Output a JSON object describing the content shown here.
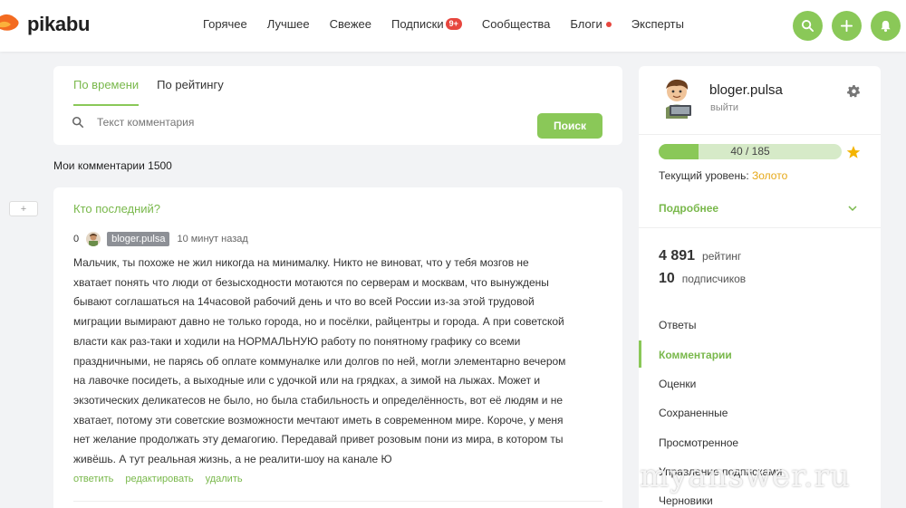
{
  "header": {
    "logo_text": "pikabu",
    "nav": [
      {
        "label": "Горячее"
      },
      {
        "label": "Лучшее"
      },
      {
        "label": "Свежее"
      },
      {
        "label": "Подписки",
        "badge": "9+"
      },
      {
        "label": "Сообщества"
      },
      {
        "label": "Блоги",
        "dot": true
      },
      {
        "label": "Эксперты"
      }
    ],
    "buttons": [
      "search-icon",
      "plus-icon",
      "bell-icon"
    ],
    "accent": "#8ac858"
  },
  "search": {
    "tabs": [
      "По времени",
      "По рейтингу"
    ],
    "active_tab": 0,
    "placeholder": "Текст комментария",
    "button_label": "Поиск"
  },
  "my_comments_label": "Мои комментарии 1500",
  "plus_label": "+",
  "comment": {
    "title": "Кто последний?",
    "score": "0",
    "author": "bloger.pulsa",
    "time": "10 минут назад",
    "lines": [
      "Мальчик, ты похоже не жил никогда на минималку. Никто не виноват, что у тебя мозгов не",
      "хватает понять что люди от безысходности мотаются по серверам и москвам, что вынуждены",
      "бывают соглашаться на 14часовой рабочий день и что во всей России из-за этой трудовой",
      "миграции вымирают давно не только города, но и посёлки, райцентры и города. А при советской",
      "власти как раз-таки и ходили на НОРМАЛЬНУЮ работу по понятному графику со всеми",
      "праздничными, не парясь об оплате коммуналке или долгов по ней, могли элементарно вечером",
      "на лавочке посидеть, а выходные или с удочкой или на грядках, а зимой на лыжах. Может и",
      "экзотических деликатесов не было, но была стабильность и определённость, вот её людям и не",
      "хватает, потому эти советские возможности мечтают иметь в современном мире. Короче, у меня",
      "нет желание продолжать эту демагогию. Передавай привет розовым пони из мира, в котором ты",
      "живёшь. А тут реальная жизнь, а не реалити-шоу на канале Ю"
    ],
    "actions": [
      "ответить",
      "редактировать",
      "удалить"
    ]
  },
  "profile": {
    "name": "bloger.pulsa",
    "logout": "выйти",
    "progress_text": "40 / 185",
    "progress_fraction": 0.216,
    "level_label": "Текущий уровень:",
    "level_value": "Золото",
    "more_label": "Подробнее",
    "rating_num": "4 891",
    "rating_label": "рейтинг",
    "subs_num": "10",
    "subs_label": "подписчиков",
    "menu": [
      "Ответы",
      "Комментарии",
      "Оценки",
      "Сохраненные",
      "Просмотренное",
      "Управление подписками",
      "Черновики"
    ],
    "active_menu": 1
  },
  "watermark": "myanswer.ru"
}
